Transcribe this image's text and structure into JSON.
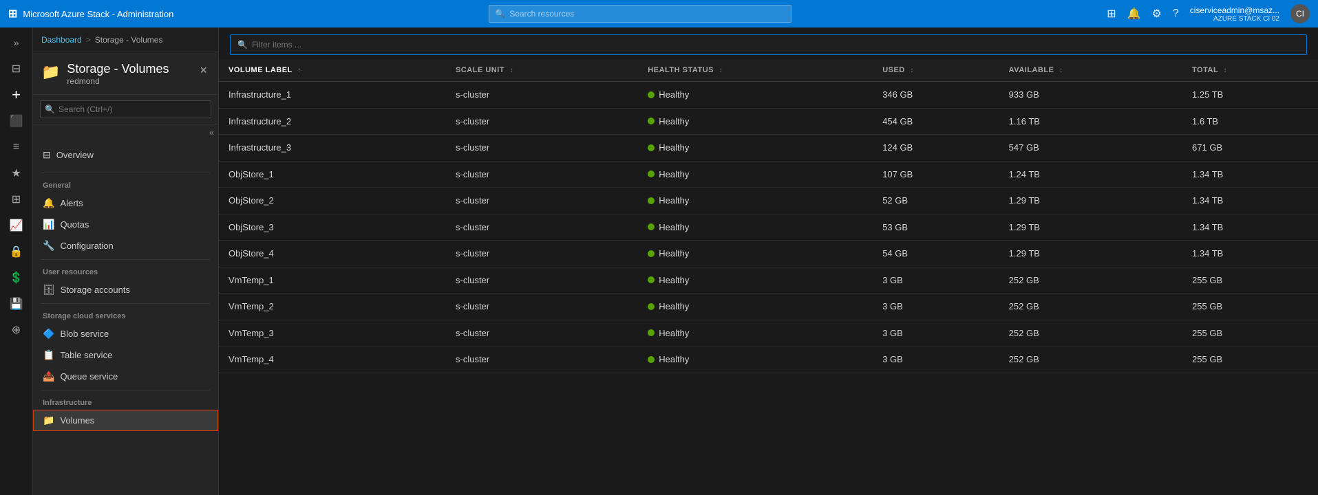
{
  "app": {
    "title": "Microsoft Azure Stack - Administration"
  },
  "topbar": {
    "title": "Microsoft Azure Stack - Administration",
    "search_placeholder": "Search resources",
    "user_name": "ciserviceadmin@msaz...",
    "user_sub": "AZURE STACK CI 02"
  },
  "breadcrumb": {
    "home": "Dashboard",
    "separator": ">",
    "current": "Storage - Volumes"
  },
  "panel": {
    "title": "Storage - Volumes",
    "subtitle": "redmond",
    "close_label": "×",
    "search_placeholder": "Search (Ctrl+/)"
  },
  "nav": {
    "overview": "Overview",
    "general_label": "General",
    "alerts": "Alerts",
    "quotas": "Quotas",
    "configuration": "Configuration",
    "user_resources_label": "User resources",
    "storage_accounts": "Storage accounts",
    "storage_cloud_label": "Storage cloud services",
    "blob_service": "Blob service",
    "table_service": "Table service",
    "queue_service": "Queue service",
    "infrastructure_label": "Infrastructure",
    "volumes": "Volumes"
  },
  "content": {
    "filter_placeholder": "Filter items ...",
    "columns": [
      {
        "key": "volume_label",
        "label": "VOLUME LABEL",
        "sorted": true
      },
      {
        "key": "scale_unit",
        "label": "SCALE UNIT"
      },
      {
        "key": "health_status",
        "label": "HEALTH STATUS"
      },
      {
        "key": "used",
        "label": "USED"
      },
      {
        "key": "available",
        "label": "AVAILABLE"
      },
      {
        "key": "total",
        "label": "TOTAL"
      }
    ],
    "rows": [
      {
        "volume_label": "Infrastructure_1",
        "scale_unit": "s-cluster",
        "health_status": "Healthy",
        "used": "346 GB",
        "available": "933 GB",
        "total": "1.25 TB"
      },
      {
        "volume_label": "Infrastructure_2",
        "scale_unit": "s-cluster",
        "health_status": "Healthy",
        "used": "454 GB",
        "available": "1.16 TB",
        "total": "1.6 TB"
      },
      {
        "volume_label": "Infrastructure_3",
        "scale_unit": "s-cluster",
        "health_status": "Healthy",
        "used": "124 GB",
        "available": "547 GB",
        "total": "671 GB"
      },
      {
        "volume_label": "ObjStore_1",
        "scale_unit": "s-cluster",
        "health_status": "Healthy",
        "used": "107 GB",
        "available": "1.24 TB",
        "total": "1.34 TB"
      },
      {
        "volume_label": "ObjStore_2",
        "scale_unit": "s-cluster",
        "health_status": "Healthy",
        "used": "52 GB",
        "available": "1.29 TB",
        "total": "1.34 TB"
      },
      {
        "volume_label": "ObjStore_3",
        "scale_unit": "s-cluster",
        "health_status": "Healthy",
        "used": "53 GB",
        "available": "1.29 TB",
        "total": "1.34 TB"
      },
      {
        "volume_label": "ObjStore_4",
        "scale_unit": "s-cluster",
        "health_status": "Healthy",
        "used": "54 GB",
        "available": "1.29 TB",
        "total": "1.34 TB"
      },
      {
        "volume_label": "VmTemp_1",
        "scale_unit": "s-cluster",
        "health_status": "Healthy",
        "used": "3 GB",
        "available": "252 GB",
        "total": "255 GB"
      },
      {
        "volume_label": "VmTemp_2",
        "scale_unit": "s-cluster",
        "health_status": "Healthy",
        "used": "3 GB",
        "available": "252 GB",
        "total": "255 GB"
      },
      {
        "volume_label": "VmTemp_3",
        "scale_unit": "s-cluster",
        "health_status": "Healthy",
        "used": "3 GB",
        "available": "252 GB",
        "total": "255 GB"
      },
      {
        "volume_label": "VmTemp_4",
        "scale_unit": "s-cluster",
        "health_status": "Healthy",
        "used": "3 GB",
        "available": "252 GB",
        "total": "255 GB"
      }
    ]
  },
  "icons": {
    "expand": "»",
    "collapse": "«",
    "search": "🔍",
    "portal": "⊞",
    "bell": "🔔",
    "settings": "⚙",
    "help": "?",
    "dashboard": "⊟",
    "create": "+",
    "resource_groups": "⬛",
    "all_resources": "≡",
    "favorites": "★",
    "grid": "⊞",
    "monitor": "📈",
    "security": "🔒",
    "cost": "💲",
    "extensions": "⊕",
    "storage_nav": "💾",
    "alerts_icon": "🔔",
    "quotas_icon": "📊",
    "config_icon": "🔧",
    "sa_icon": "🗄",
    "blob_icon": "🔷",
    "table_icon": "📋",
    "queue_icon": "📤",
    "volumes_icon": "📁",
    "sort_up": "↑",
    "sort_both": "↕"
  }
}
